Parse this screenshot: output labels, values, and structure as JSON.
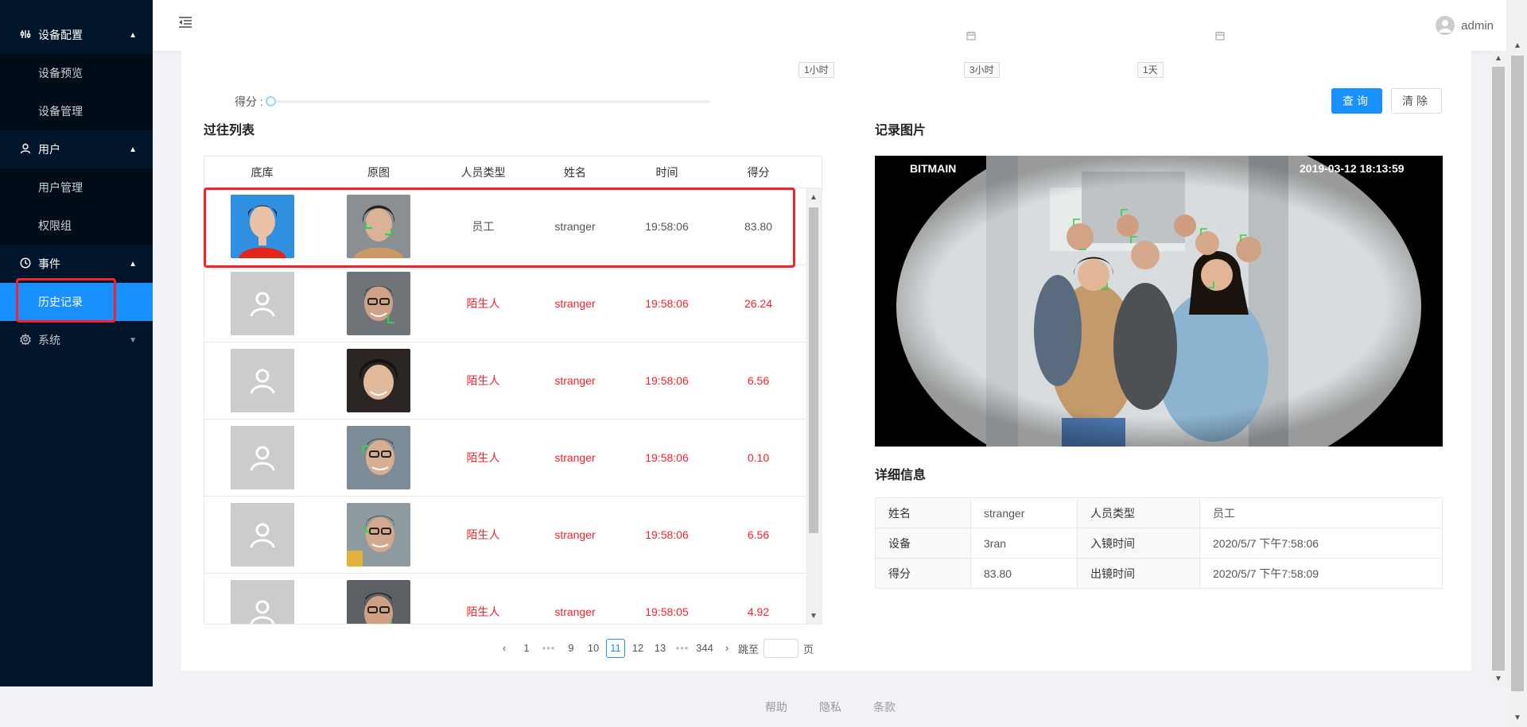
{
  "sidebar": {
    "groups": [
      {
        "label": "设备配置",
        "icon": "sliders-icon",
        "items": [
          "设备预览",
          "设备管理"
        ]
      },
      {
        "label": "用户",
        "icon": "user-icon",
        "items": [
          "用户管理",
          "权限组"
        ]
      },
      {
        "label": "事件",
        "icon": "clock-icon",
        "items": [
          "历史记录"
        ]
      },
      {
        "label": "系统",
        "icon": "gear-icon",
        "items": []
      }
    ],
    "active_item": "历史记录"
  },
  "header": {
    "username": "admin"
  },
  "filters": {
    "quick_ranges": [
      "1小时",
      "3小时",
      "1天"
    ],
    "score_label": "得分 :",
    "query_button": "查询",
    "clear_button": "清除"
  },
  "pass_list": {
    "title": "过往列表",
    "columns": [
      "底库",
      "原图",
      "人员类型",
      "姓名",
      "时间",
      "得分"
    ],
    "rows": [
      {
        "type": "员工",
        "name": "stranger",
        "time": "19:58:06",
        "score": "83.80"
      },
      {
        "type": "陌生人",
        "name": "stranger",
        "time": "19:58:06",
        "score": "26.24"
      },
      {
        "type": "陌生人",
        "name": "stranger",
        "time": "19:58:06",
        "score": "6.56"
      },
      {
        "type": "陌生人",
        "name": "stranger",
        "time": "19:58:06",
        "score": "0.10"
      },
      {
        "type": "陌生人",
        "name": "stranger",
        "time": "19:58:06",
        "score": "6.56"
      },
      {
        "type": "陌生人",
        "name": "stranger",
        "time": "19:58:05",
        "score": "4.92"
      }
    ]
  },
  "pagination": {
    "pages": [
      "1",
      "•••",
      "9",
      "10",
      "11",
      "12",
      "13",
      "•••",
      "344"
    ],
    "current": "11",
    "jump_label": "跳至",
    "page_label": "页"
  },
  "record": {
    "title": "记录图片",
    "brand_text": "BITMAIN",
    "timestamp_text": "2019-03-12  18:13:59"
  },
  "detail": {
    "title": "详细信息",
    "rows": [
      [
        "姓名",
        "stranger",
        "人员类型",
        "员工"
      ],
      [
        "设备",
        "3ran",
        "入镜时间",
        "2020/5/7 下午7:58:06"
      ],
      [
        "得分",
        "83.80",
        "出镜时间",
        "2020/5/7 下午7:58:09"
      ]
    ]
  },
  "footer": {
    "links": [
      "帮助",
      "隐私",
      "条款"
    ]
  },
  "colors": {
    "sidebar_bg": "#001529",
    "accent": "#1890ff",
    "alert_red": "#f5222d"
  }
}
